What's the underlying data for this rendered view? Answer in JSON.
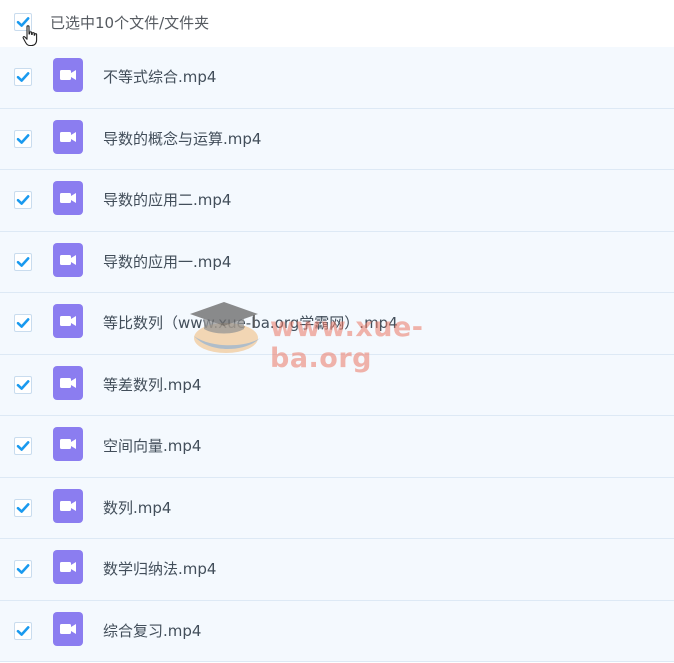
{
  "selection": {
    "summary": "已选中10个文件/文件夹",
    "all_checked": true
  },
  "colors": {
    "check_blue": "#1a9aef",
    "video_icon_purple": "#8b7df0",
    "row_background": "#f4f9fe"
  },
  "files": [
    {
      "name": "不等式综合.mp4",
      "checked": true,
      "icon": "video-file-icon"
    },
    {
      "name": "导数的概念与运算.mp4",
      "checked": true,
      "icon": "video-file-icon"
    },
    {
      "name": "导数的应用二.mp4",
      "checked": true,
      "icon": "video-file-icon"
    },
    {
      "name": "导数的应用一.mp4",
      "checked": true,
      "icon": "video-file-icon"
    },
    {
      "name": "等比数列（www.xue-ba.org学霸网）.mp4",
      "checked": true,
      "icon": "video-file-icon"
    },
    {
      "name": "等差数列.mp4",
      "checked": true,
      "icon": "video-file-icon"
    },
    {
      "name": "空间向量.mp4",
      "checked": true,
      "icon": "video-file-icon"
    },
    {
      "name": "数列.mp4",
      "checked": true,
      "icon": "video-file-icon"
    },
    {
      "name": "数学归纳法.mp4",
      "checked": true,
      "icon": "video-file-icon"
    },
    {
      "name": "综合复习.mp4",
      "checked": true,
      "icon": "video-file-icon"
    }
  ],
  "watermark": {
    "text": "www.xue-ba.org",
    "icon": "graduation-cap-icon"
  }
}
